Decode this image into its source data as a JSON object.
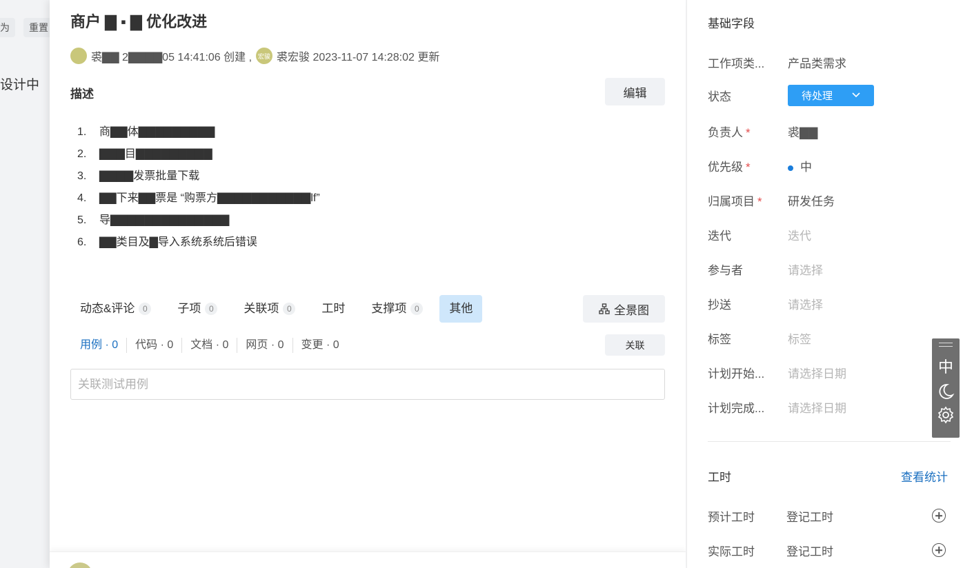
{
  "background": {
    "btn_left": "为",
    "btn_reset": "重置",
    "status_text": "设计中"
  },
  "item": {
    "title": "商户 ▇ ▪ ▇ 优化改进",
    "creator_avatar_text": "",
    "creator_text": "裘▇▇ 2▇▇▇▇05 14:41:06 创建 ,",
    "updater_avatar_text": "宏骏",
    "updater_text": "裘宏骏 2023-11-07 14:28:02 更新"
  },
  "description": {
    "label": "描述",
    "edit_label": "编辑",
    "items": [
      {
        "num": "1.",
        "text": "商▇▇体▇▇▇▇▇▇▇▇▇"
      },
      {
        "num": "2.",
        "text": "▇▇▇目▇▇▇▇▇▇▇▇▇"
      },
      {
        "num": "3.",
        "text": "▇▇▇▇发票批量下载"
      },
      {
        "num": "4.",
        "text": "▇▇下来▇▇票是 “购票方▇▇▇▇▇▇▇▇▇▇▇lf”"
      },
      {
        "num": "5.",
        "text": "导▇▇▇▇▇▇▇▇▇▇▇▇▇▇"
      },
      {
        "num": "6.",
        "text": "▇▇类目及▇导入系统系统后错误"
      }
    ]
  },
  "tabs": [
    {
      "label": "动态&评论",
      "count": "0"
    },
    {
      "label": "子项",
      "count": "0"
    },
    {
      "label": "关联项",
      "count": "0"
    },
    {
      "label": "工时",
      "count": ""
    },
    {
      "label": "支撑项",
      "count": "0"
    },
    {
      "label": "其他",
      "count": ""
    }
  ],
  "panorama_label": "全景图",
  "subtabs": [
    "用例 · 0",
    "代码 · 0",
    "文档 · 0",
    "网页 · 0",
    "变更 · 0"
  ],
  "link_label": "关联",
  "search_placeholder": "关联测试用例",
  "right_panel": {
    "title": "基础字段",
    "fields": {
      "type_label": "工作项类...",
      "type_value": "产品类需求",
      "status_label": "状态",
      "status_value": "待处理",
      "assignee_label": "负责人",
      "assignee_value": "裘▇▇",
      "priority_label": "优先级",
      "priority_value": "中",
      "project_label": "归属项目",
      "project_value": "研发任务",
      "iteration_label": "迭代",
      "iteration_value": "迭代",
      "participants_label": "参与者",
      "participants_value": "请选择",
      "cc_label": "抄送",
      "cc_value": "请选择",
      "tags_label": "标签",
      "tags_value": "标签",
      "plan_start_label": "计划开始...",
      "plan_start_value": "请选择日期",
      "plan_end_label": "计划完成...",
      "plan_end_value": "请选择日期",
      "required_mark": "*"
    },
    "worktime": {
      "title": "工时",
      "stats_link": "查看统计",
      "estimated_label": "预计工时",
      "estimated_value": "登记工时",
      "actual_label": "实际工时",
      "actual_value": "登记工时"
    }
  },
  "float_tool": {
    "lang": "中"
  },
  "colors": {
    "accent": "#2e9ef5",
    "link": "#1a6fc0",
    "active_tab_bg": "#cfe7fb",
    "required": "#e34d4d"
  }
}
